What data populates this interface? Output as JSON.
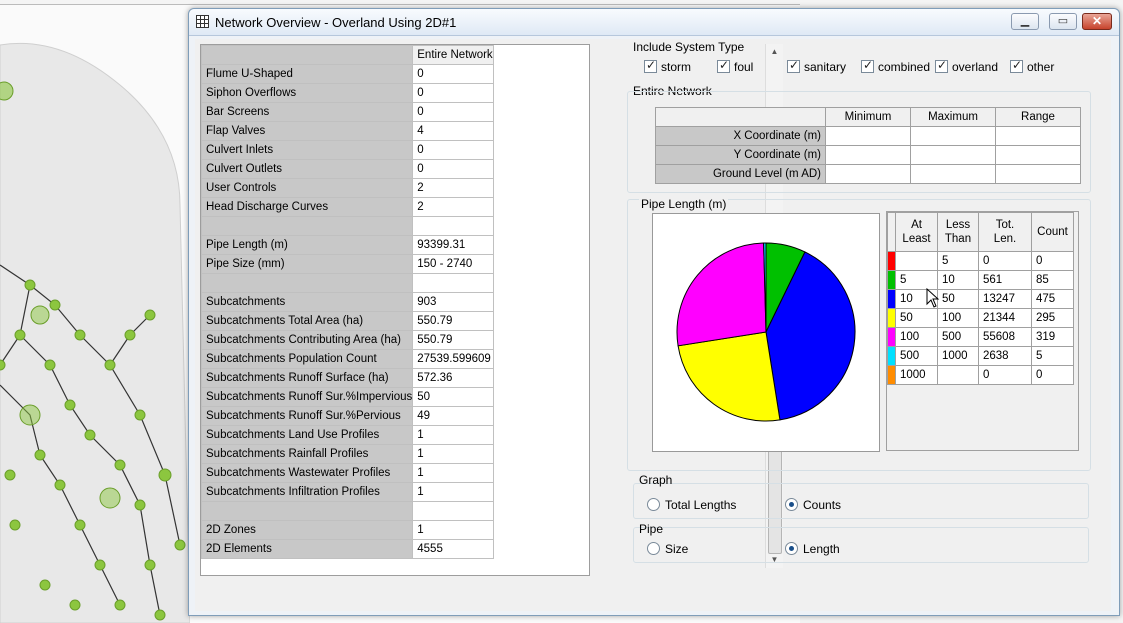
{
  "window": {
    "title": "Network Overview - Overland Using 2D#1"
  },
  "left_grid": {
    "column_header": "Entire Network",
    "rows": [
      {
        "label": "Flume U-Shaped",
        "value": "0"
      },
      {
        "label": "Siphon Overflows",
        "value": "0"
      },
      {
        "label": "Bar Screens",
        "value": "0"
      },
      {
        "label": "Flap Valves",
        "value": "4"
      },
      {
        "label": "Culvert Inlets",
        "value": "0"
      },
      {
        "label": "Culvert Outlets",
        "value": "0"
      },
      {
        "label": "User Controls",
        "value": "2"
      },
      {
        "label": "Head Discharge Curves",
        "value": "2"
      },
      {
        "label": "",
        "value": ""
      },
      {
        "label": "Pipe Length (m)",
        "value": "93399.31"
      },
      {
        "label": "Pipe Size (mm)",
        "value": "150 - 2740"
      },
      {
        "label": "",
        "value": ""
      },
      {
        "label": "Subcatchments",
        "value": "903"
      },
      {
        "label": "Subcatchments Total Area (ha)",
        "value": "550.79"
      },
      {
        "label": "Subcatchments Contributing Area (ha)",
        "value": "550.79"
      },
      {
        "label": "Subcatchments Population Count",
        "value": "27539.599609"
      },
      {
        "label": "Subcatchments Runoff Surface (ha)",
        "value": "572.36"
      },
      {
        "label": "Subcatchments Runoff Sur.%Impervious",
        "value": "50"
      },
      {
        "label": "Subcatchments Runoff Sur.%Pervious",
        "value": "49"
      },
      {
        "label": "Subcatchments Land Use Profiles",
        "value": "1"
      },
      {
        "label": "Subcatchments Rainfall Profiles",
        "value": "1"
      },
      {
        "label": "Subcatchments Wastewater Profiles",
        "value": "1"
      },
      {
        "label": "Subcatchments Infiltration Profiles",
        "value": "1"
      },
      {
        "label": "",
        "value": ""
      },
      {
        "label": "2D Zones",
        "value": "1"
      },
      {
        "label": "2D Elements",
        "value": "4555"
      }
    ]
  },
  "system_type": {
    "label": "Include System Type",
    "options": [
      {
        "label": "storm",
        "checked": true
      },
      {
        "label": "foul",
        "checked": true
      },
      {
        "label": "sanitary",
        "checked": true
      },
      {
        "label": "combined",
        "checked": true
      },
      {
        "label": "overland",
        "checked": true
      },
      {
        "label": "other",
        "checked": true
      }
    ]
  },
  "entire_network": {
    "label": "Entire Network",
    "headers": [
      "Minimum",
      "Maximum",
      "Range"
    ],
    "rows": [
      {
        "label": "X Coordinate (m)",
        "min": "",
        "max": "",
        "range": ""
      },
      {
        "label": "Y Coordinate (m)",
        "min": "",
        "max": "",
        "range": ""
      },
      {
        "label": "Ground Level (m AD)",
        "min": "",
        "max": "",
        "range": ""
      }
    ]
  },
  "pipe_length": {
    "label": "Pipe Length (m)",
    "table_headers": {
      "at_least": "At Least",
      "less_than": "Less Than",
      "tot_len": "Tot. Len.",
      "count": "Count"
    },
    "bins": [
      {
        "color": "#ff0000",
        "at_least": "",
        "less_than": "5",
        "tot_len": "0",
        "count": "0"
      },
      {
        "color": "#00c000",
        "at_least": "5",
        "less_than": "10",
        "tot_len": "561",
        "count": "85"
      },
      {
        "color": "#0000ff",
        "at_least": "10",
        "less_than": "50",
        "tot_len": "13247",
        "count": "475"
      },
      {
        "color": "#ffff00",
        "at_least": "50",
        "less_than": "100",
        "tot_len": "21344",
        "count": "295"
      },
      {
        "color": "#ff00ff",
        "at_least": "100",
        "less_than": "500",
        "tot_len": "55608",
        "count": "319"
      },
      {
        "color": "#00e0ff",
        "at_least": "500",
        "less_than": "1000",
        "tot_len": "2638",
        "count": "5"
      },
      {
        "color": "#ff8c00",
        "at_least": "1000",
        "less_than": "",
        "tot_len": "0",
        "count": "0"
      }
    ]
  },
  "chart_data": {
    "type": "pie",
    "categories": [
      "<5",
      "5-10",
      "10-50",
      "50-100",
      "100-500",
      "500-1000",
      ">=1000"
    ],
    "values": [
      0,
      85,
      475,
      295,
      319,
      5,
      0
    ],
    "colors": [
      "#ff0000",
      "#00c000",
      "#0000ff",
      "#ffff00",
      "#ff00ff",
      "#00e0ff",
      "#ff8c00"
    ],
    "title": ""
  },
  "graph": {
    "label": "Graph",
    "options": [
      {
        "label": "Total Lengths",
        "selected": false
      },
      {
        "label": "Counts",
        "selected": true
      }
    ]
  },
  "pipe": {
    "label": "Pipe",
    "options": [
      {
        "label": "Size",
        "selected": false
      },
      {
        "label": "Length",
        "selected": true
      }
    ]
  },
  "colors": {
    "title_bar": "#dfe9f5",
    "grid_label_bg": "#c8c8c8",
    "close_button": "#c7432c"
  }
}
